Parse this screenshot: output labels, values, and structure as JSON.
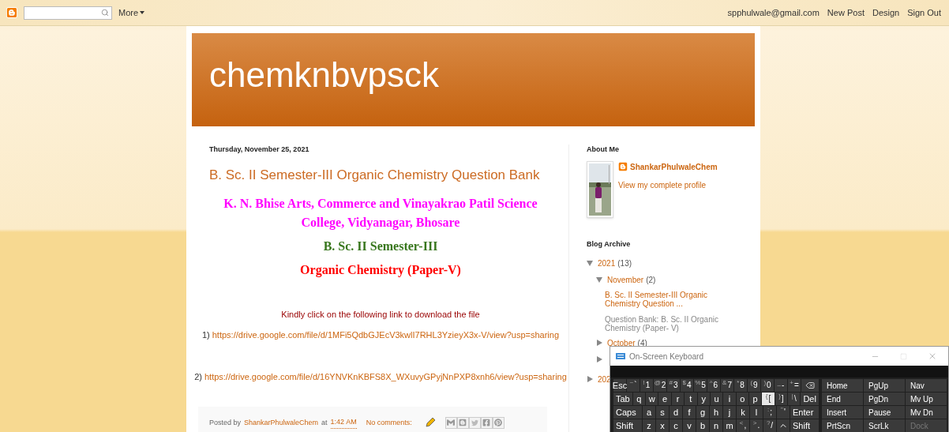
{
  "navbar": {
    "more": "More",
    "links": [
      "spphulwale@gmail.com",
      "New Post",
      "Design",
      "Sign Out"
    ]
  },
  "header": {
    "title": "chemknbvpsck"
  },
  "post": {
    "date": "Thursday, November 25, 2021",
    "title": "B. Sc. II Semester-III Organic Chemistry Question Bank",
    "body": [
      {
        "kind": "heading",
        "text": "K. N. Bhise Arts, Commerce and Vinayakrao Patil Science College, Vidyanagar, Bhosare",
        "color": "#ff00ff"
      },
      {
        "kind": "heading",
        "text": "B. Sc. II  Semester-III",
        "color": "#38761d"
      },
      {
        "kind": "heading",
        "text": "Organic Chemistry (Paper-V)",
        "color": "#ff0000"
      },
      {
        "kind": "note",
        "text": "Kindly click on the following link to download the file"
      },
      {
        "kind": "link",
        "number": "1)",
        "url": "https://drive.google.com/file/d/1MFi5QdbGJEcV3kwlI7RHL3YzieyX3x-V/view?usp=sharing"
      },
      {
        "kind": "link",
        "number": "2)",
        "url": "https://drive.google.com/file/d/16YNVKnKBFS8X_WXuvyGPyjNnPXP8xnh6/view?usp=sharing"
      }
    ],
    "footer": {
      "posted_by": "Posted by",
      "author": "ShankarPhulwaleChem",
      "at": "at",
      "time": "1:42 AM",
      "comments": "No comments:"
    }
  },
  "sidebar": {
    "about": {
      "heading": "About Me",
      "name": "ShankarPhulwaleChem",
      "profile_link": "View my complete profile"
    },
    "archive": {
      "heading": "Blog Archive",
      "items": [
        {
          "label": "2021",
          "count": "(13)",
          "expanded": true,
          "children": [
            {
              "label": "November",
              "count": "(2)",
              "expanded": true,
              "posts": [
                "B. Sc. II Semester-III Organic Chemistry Question ...",
                "Question Bank: B. Sc. II Organic Chemistry (Paper- V)"
              ]
            },
            {
              "label": "October",
              "count": "(4)",
              "expanded": false
            },
            {
              "expanded": false
            }
          ]
        },
        {
          "label": "202",
          "expanded": false
        }
      ]
    }
  },
  "keyboard": {
    "title": "On-Screen Keyboard",
    "rows": [
      [
        {
          "kind": "small",
          "main": "Esc",
          "selected": false
        },
        {
          "kind": "pair",
          "shift": "~",
          "main": "`",
          "selected": false
        },
        {
          "kind": "pair",
          "shift": "!",
          "main": "1",
          "selected": false
        },
        {
          "kind": "pair",
          "shift": "@",
          "main": "2",
          "selected": false
        },
        {
          "kind": "pair",
          "shift": "#",
          "main": "3",
          "selected": false
        },
        {
          "kind": "pair",
          "shift": "$",
          "main": "4",
          "selected": false
        },
        {
          "kind": "pair",
          "shift": "%",
          "main": "5",
          "selected": false
        },
        {
          "kind": "pair",
          "shift": "^",
          "main": "6",
          "selected": false
        },
        {
          "kind": "pair",
          "shift": "&",
          "main": "7",
          "selected": false
        },
        {
          "kind": "pair",
          "shift": "*",
          "main": "8",
          "selected": false
        },
        {
          "kind": "pair",
          "shift": "(",
          "main": "9",
          "selected": false
        },
        {
          "kind": "pair",
          "shift": ")",
          "main": "0",
          "selected": false
        },
        {
          "kind": "pair",
          "shift": "_",
          "main": "-",
          "selected": false
        },
        {
          "kind": "pair",
          "shift": "+",
          "main": "=",
          "selected": false
        },
        {
          "kind": "backspace",
          "selected": false
        }
      ],
      [
        {
          "kind": "wide",
          "main": "Tab",
          "selected": false
        },
        {
          "kind": "letter",
          "main": "q",
          "selected": false
        },
        {
          "kind": "letter",
          "main": "w",
          "selected": false
        },
        {
          "kind": "letter",
          "main": "e",
          "selected": false
        },
        {
          "kind": "letter",
          "main": "r",
          "selected": false
        },
        {
          "kind": "letter",
          "main": "t",
          "selected": false
        },
        {
          "kind": "letter",
          "main": "y",
          "selected": false
        },
        {
          "kind": "letter",
          "main": "u",
          "selected": false
        },
        {
          "kind": "letter",
          "main": "i",
          "selected": false
        },
        {
          "kind": "letter",
          "main": "o",
          "selected": false
        },
        {
          "kind": "letter",
          "main": "p",
          "selected": false
        },
        {
          "kind": "pair",
          "shift": "{",
          "main": "[",
          "selected": true
        },
        {
          "kind": "pair",
          "shift": "}",
          "main": "]",
          "selected": false
        },
        {
          "kind": "pair",
          "shift": "|",
          "main": "\\",
          "selected": false
        },
        {
          "kind": "wide",
          "main": "Del",
          "selected": false
        }
      ],
      [
        {
          "kind": "wide",
          "main": "Caps",
          "selected": false
        },
        {
          "kind": "letter",
          "main": "a",
          "selected": false
        },
        {
          "kind": "letter",
          "main": "s",
          "selected": false
        },
        {
          "kind": "letter",
          "main": "d",
          "selected": false
        },
        {
          "kind": "letter",
          "main": "f",
          "selected": false
        },
        {
          "kind": "letter",
          "main": "g",
          "selected": false
        },
        {
          "kind": "letter",
          "main": "h",
          "selected": false
        },
        {
          "kind": "letter",
          "main": "j",
          "selected": false
        },
        {
          "kind": "letter",
          "main": "k",
          "selected": false
        },
        {
          "kind": "letter",
          "main": "l",
          "selected": false
        },
        {
          "kind": "pair",
          "shift": ":",
          "main": ";",
          "selected": false
        },
        {
          "kind": "pair",
          "shift": "\"",
          "main": "'",
          "selected": false
        },
        {
          "kind": "wide",
          "main": "Enter",
          "selected": false
        }
      ],
      [
        {
          "kind": "wide",
          "main": "Shift",
          "selected": false
        },
        {
          "kind": "letter",
          "main": "z",
          "selected": false
        },
        {
          "kind": "letter",
          "main": "x",
          "selected": false
        },
        {
          "kind": "letter",
          "main": "c",
          "selected": false
        },
        {
          "kind": "letter",
          "main": "v",
          "selected": false
        },
        {
          "kind": "letter",
          "main": "b",
          "selected": false
        },
        {
          "kind": "letter",
          "main": "n",
          "selected": false
        },
        {
          "kind": "letter",
          "main": "m",
          "selected": false
        },
        {
          "kind": "pair",
          "shift": "<",
          "main": ",",
          "selected": false
        },
        {
          "kind": "pair",
          "shift": ">",
          "main": ".",
          "selected": false
        },
        {
          "kind": "pair",
          "shift": "?",
          "main": "/",
          "selected": false
        },
        {
          "kind": "up",
          "selected": false
        },
        {
          "kind": "wide",
          "main": "Shift",
          "selected": false
        }
      ]
    ],
    "nav_keys": [
      [
        {
          "label": "Home",
          "disabled": false
        },
        {
          "label": "PgUp",
          "disabled": false
        },
        {
          "label": "Nav",
          "disabled": false
        }
      ],
      [
        {
          "label": "End",
          "disabled": false
        },
        {
          "label": "PgDn",
          "disabled": false
        },
        {
          "label": "Mv Up",
          "disabled": false
        }
      ],
      [
        {
          "label": "Insert",
          "disabled": false
        },
        {
          "label": "Pause",
          "disabled": false
        },
        {
          "label": "Mv Dn",
          "disabled": false
        }
      ],
      [
        {
          "label": "PrtScn",
          "disabled": false
        },
        {
          "label": "ScrLk",
          "disabled": false
        },
        {
          "label": "Dock",
          "disabled": true
        }
      ]
    ]
  }
}
